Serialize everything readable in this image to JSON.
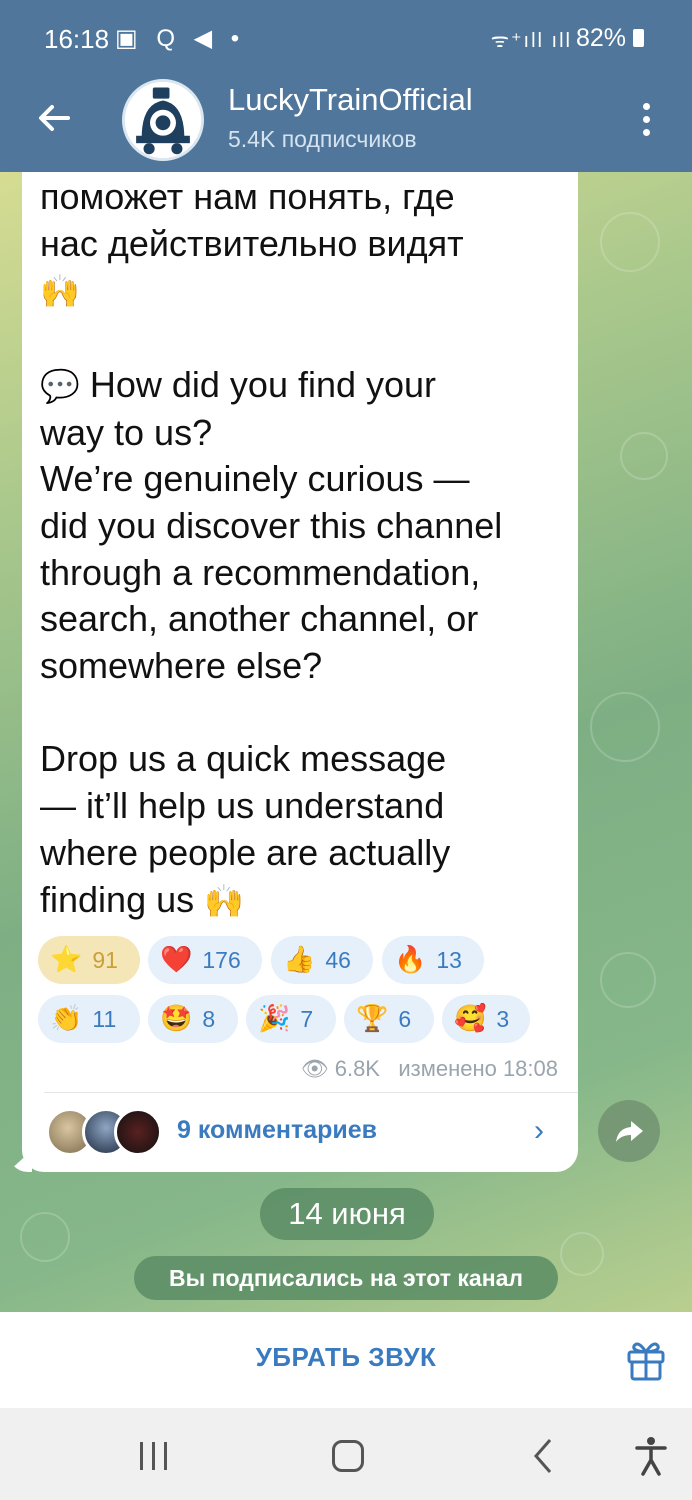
{
  "status_bar": {
    "time": "16:18",
    "left_icons": "▣ Q ◀ •",
    "signal": "ᯤ⁺ıll ıll",
    "battery": "82%"
  },
  "header": {
    "title": "LuckyTrainOfficial",
    "subtitle": "5.4K подписчиков"
  },
  "message": {
    "lines_ru": [
      "поможет нам понять, где",
      "нас действительно видят"
    ],
    "emoji_hands": "🙌",
    "emoji_speech": "💬",
    "para_en_1": [
      "How did you find your",
      "way to us?",
      "We’re genuinely curious —",
      "did you discover this channel",
      "through a recommendation,",
      "search, another channel, or",
      "somewhere else?"
    ],
    "para_en_2": [
      "Drop us a quick message",
      "— it’ll help us understand",
      "where people are actually",
      "finding us"
    ]
  },
  "reactions": [
    {
      "emoji": "⭐",
      "count": "91"
    },
    {
      "emoji": "❤️",
      "count": "176"
    },
    {
      "emoji": "👍",
      "count": "46"
    },
    {
      "emoji": "🔥",
      "count": "13"
    },
    {
      "emoji": "👏",
      "count": "11"
    },
    {
      "emoji": "🤩",
      "count": "8"
    },
    {
      "emoji": "🎉",
      "count": "7"
    },
    {
      "emoji": "🏆",
      "count": "6"
    },
    {
      "emoji": "🥰",
      "count": "3"
    }
  ],
  "meta": {
    "views": "6.8K",
    "edited": "изменено 18:08"
  },
  "comments": {
    "label": "9 комментариев"
  },
  "date_pill": "14 июня",
  "service_message": "Вы подписались на этот канал",
  "bottom": {
    "mute_label": "УБРАТЬ ЗВУК"
  },
  "colors": {
    "header": "#50779b",
    "accent": "#3a7bbf",
    "reaction_bg": "#e6f0fa"
  }
}
